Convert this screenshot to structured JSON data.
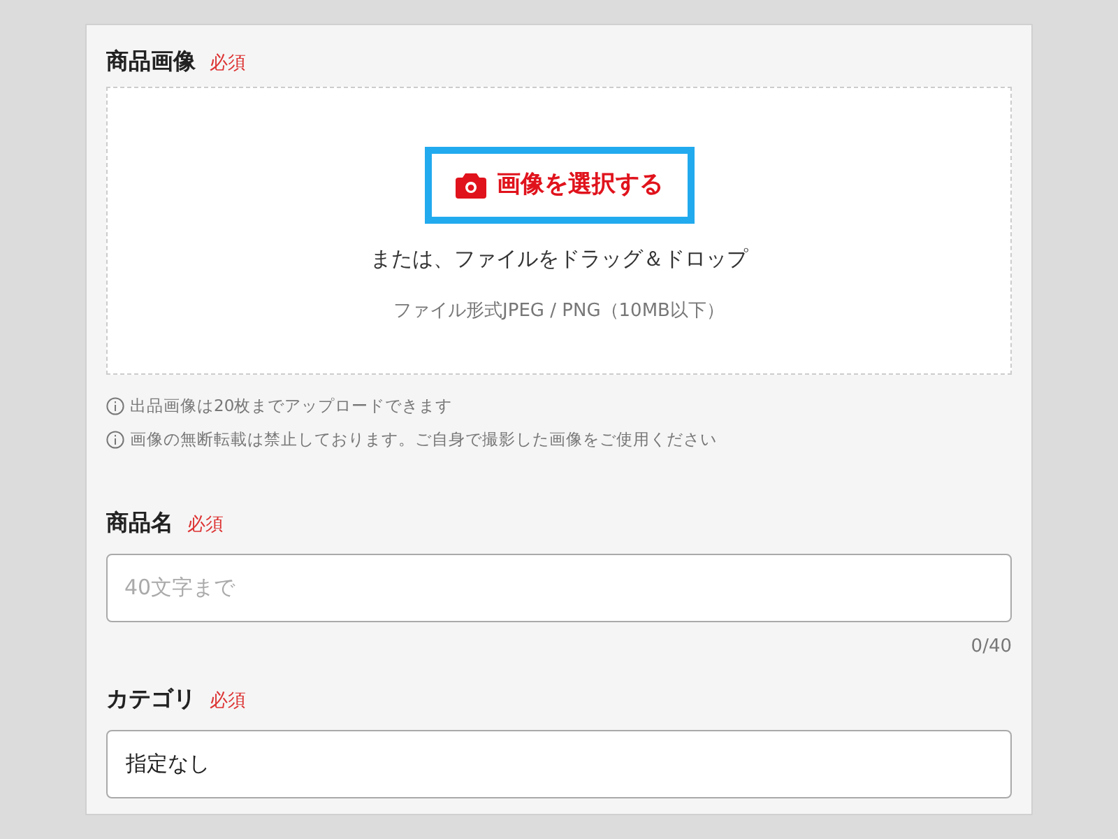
{
  "image_section": {
    "label": "商品画像",
    "required": "必須",
    "select_button": "画像を選択する",
    "drop_text": "または、ファイルをドラッグ＆ドロップ",
    "format_note": "ファイル形式JPEG / PNG（10MB以下）"
  },
  "notes": [
    "出品画像は20枚までアップロードできます",
    "画像の無断転載は禁止しております。ご自身で撮影した画像をご使用ください"
  ],
  "name_section": {
    "label": "商品名",
    "required": "必須",
    "placeholder": "40文字まで",
    "counter": "0/40"
  },
  "category_section": {
    "label": "カテゴリ",
    "required": "必須",
    "value": "指定なし"
  }
}
